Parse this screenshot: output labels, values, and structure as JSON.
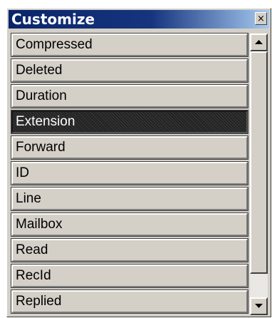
{
  "window": {
    "title": "Customize",
    "close_glyph": "×"
  },
  "list": {
    "selected_index": 3,
    "items": [
      {
        "label": "Compressed"
      },
      {
        "label": "Deleted"
      },
      {
        "label": "Duration"
      },
      {
        "label": "Extension"
      },
      {
        "label": "Forward"
      },
      {
        "label": "ID"
      },
      {
        "label": "Line"
      },
      {
        "label": "Mailbox"
      },
      {
        "label": "Read"
      },
      {
        "label": "RecId"
      },
      {
        "label": "Replied"
      }
    ]
  },
  "scrollbar": {
    "up_icon": "arrow-up-icon",
    "down_icon": "arrow-down-icon",
    "visible_fraction": 0.9,
    "position": 0
  }
}
